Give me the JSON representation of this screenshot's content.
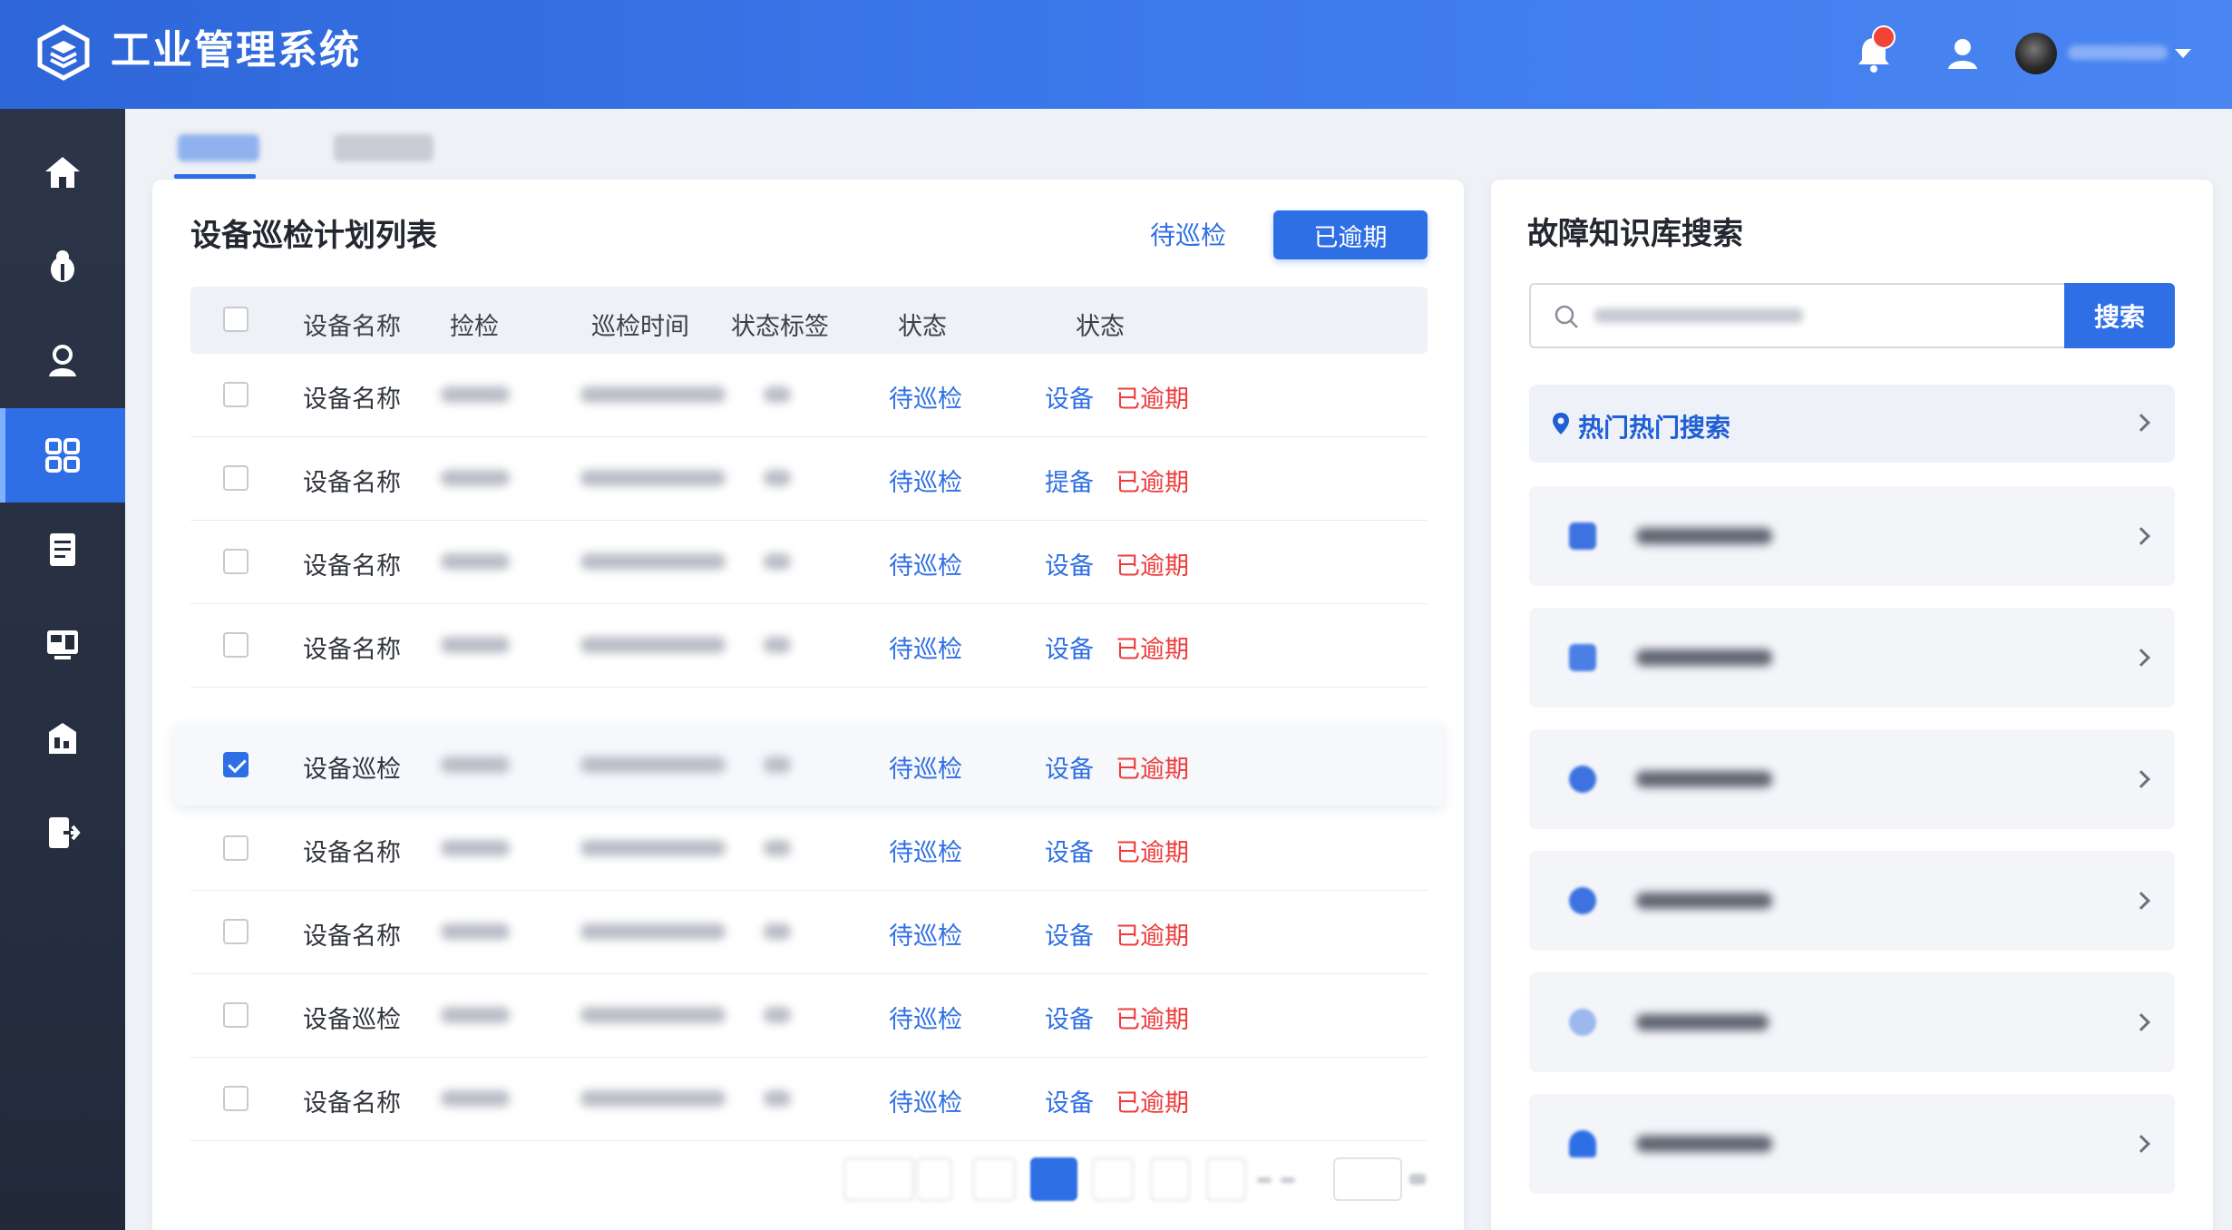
{
  "app": {
    "title": "工业管理系统"
  },
  "colors": {
    "primary": "#2e6fe6",
    "danger": "#ef3b3b",
    "sidebar": "#252d3d"
  },
  "header": {
    "icons": [
      "bell-icon",
      "user-icon",
      "avatar",
      "chevron-down-icon"
    ]
  },
  "sidebar": {
    "items": [
      {
        "icon": "home-icon",
        "active": false
      },
      {
        "icon": "bug-icon",
        "active": false
      },
      {
        "icon": "person-icon",
        "active": false
      },
      {
        "icon": "grid-icon",
        "active": true
      },
      {
        "icon": "document-icon",
        "active": false
      },
      {
        "icon": "dashboard-icon",
        "active": false
      },
      {
        "icon": "report-icon",
        "active": false
      },
      {
        "icon": "export-icon",
        "active": false
      }
    ]
  },
  "main": {
    "title": "设备巡检计划列表",
    "filter_pending": "待巡检",
    "filter_overdue": "已逾期",
    "columns": [
      "设备名称",
      "捡检",
      "巡检时间",
      "状态标签",
      "状态",
      "状态"
    ],
    "rows": [
      {
        "name": "设备名称",
        "status": "待巡检",
        "action": "设备",
        "overdue": "已逾期",
        "checked": false
      },
      {
        "name": "设备名称",
        "status": "待巡检",
        "action": "提备",
        "overdue": "已逾期",
        "checked": false
      },
      {
        "name": "设备名称",
        "status": "待巡检",
        "action": "设备",
        "overdue": "已逾期",
        "checked": false
      },
      {
        "name": "设备名称",
        "status": "待巡检",
        "action": "设备",
        "overdue": "已逾期",
        "checked": false
      },
      {
        "name": "设备巡检",
        "status": "待巡检",
        "action": "设备",
        "overdue": "已逾期",
        "checked": true
      },
      {
        "name": "设备名称",
        "status": "待巡检",
        "action": "设备",
        "overdue": "已逾期",
        "checked": false
      },
      {
        "name": "设备名称",
        "status": "待巡检",
        "action": "设备",
        "overdue": "已逾期",
        "checked": false
      },
      {
        "name": "设备巡检",
        "status": "待巡检",
        "action": "设备",
        "overdue": "已逾期",
        "checked": false
      },
      {
        "name": "设备名称",
        "status": "待巡检",
        "action": "设备",
        "overdue": "已逾期",
        "checked": false
      }
    ]
  },
  "knowledge": {
    "title": "故障知识库搜索",
    "search_button": "搜索",
    "hot_label": "热门热门搜索"
  }
}
